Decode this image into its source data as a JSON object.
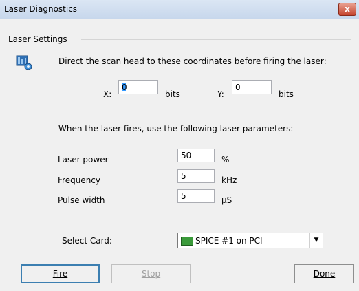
{
  "window": {
    "title": "Laser Diagnostics",
    "close_glyph": "x"
  },
  "group": {
    "label": "Laser Settings"
  },
  "scan": {
    "instruction": "Direct the scan head to these coordinates before firing the laser:",
    "x_label": "X:",
    "x_value": "0",
    "x_unit": "bits",
    "y_label": "Y:",
    "y_value": "0",
    "y_unit": "bits"
  },
  "params": {
    "instruction": "When the laser fires, use the following laser parameters:",
    "power_label": "Laser power",
    "power_value": "50",
    "power_unit": "%",
    "frequency_label": "Frequency",
    "frequency_value": "5",
    "frequency_unit": "kHz",
    "pulse_label": "Pulse width",
    "pulse_value": "5",
    "pulse_unit": "µS"
  },
  "card": {
    "label": "Select Card:",
    "selected": "SPICE #1 on PCI",
    "icon": "pci-card-icon"
  },
  "buttons": {
    "fire": "Fire",
    "stop": "Stop",
    "done": "Done"
  }
}
